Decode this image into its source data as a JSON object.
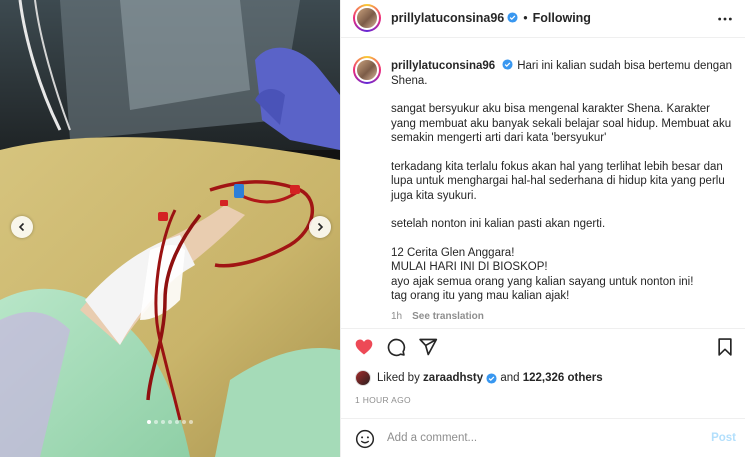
{
  "colors": {
    "link_blue": "#0095f6",
    "verified_blue": "#3897f0",
    "like_red": "#ed4956",
    "muted": "#8e8e8e"
  },
  "post": {
    "username": "prillylatuconsina96",
    "following_label": "Following",
    "caption": {
      "first_line": "Hari ini kalian sudah bisa bertemu dengan Shena.",
      "paragraphs": [
        "sangat bersyukur aku bisa mengenal karakter Shena. Karakter yang membuat aku banyak sekali belajar soal hidup. Membuat aku semakin mengerti arti dari kata 'bersyukur'",
        "terkadang kita terlalu fokus akan hal yang terlihat lebih besar dan lupa untuk menghargai hal-hal sederhana di hidup kita yang perlu juga kita syukuri.",
        "setelah nonton ini kalian pasti akan ngerti."
      ],
      "final_lines": [
        "12 Cerita Glen Anggara!",
        "MULAI HARI INI DI BIOSKOP!",
        "ayo ajak semua orang yang kalian sayang untuk nonton ini!",
        "tag orang itu yang mau kalian ajak!"
      ],
      "time_ago": "1h",
      "see_translation": "See translation"
    },
    "likes": {
      "prefix": "Liked by",
      "user": "zaraadhsty",
      "joiner": "and",
      "count": "122,326 others"
    },
    "timestamp": "1 HOUR AGO",
    "comment": {
      "placeholder": "Add a comment...",
      "post_label": "Post"
    },
    "carousel": {
      "slide_count": 7,
      "active_index": 0
    },
    "icons": [
      "more-icon",
      "heart-icon",
      "comment-icon",
      "share-icon",
      "bookmark-icon",
      "emoji-icon",
      "verified-icon",
      "chevron-left-icon",
      "chevron-right-icon"
    ]
  }
}
